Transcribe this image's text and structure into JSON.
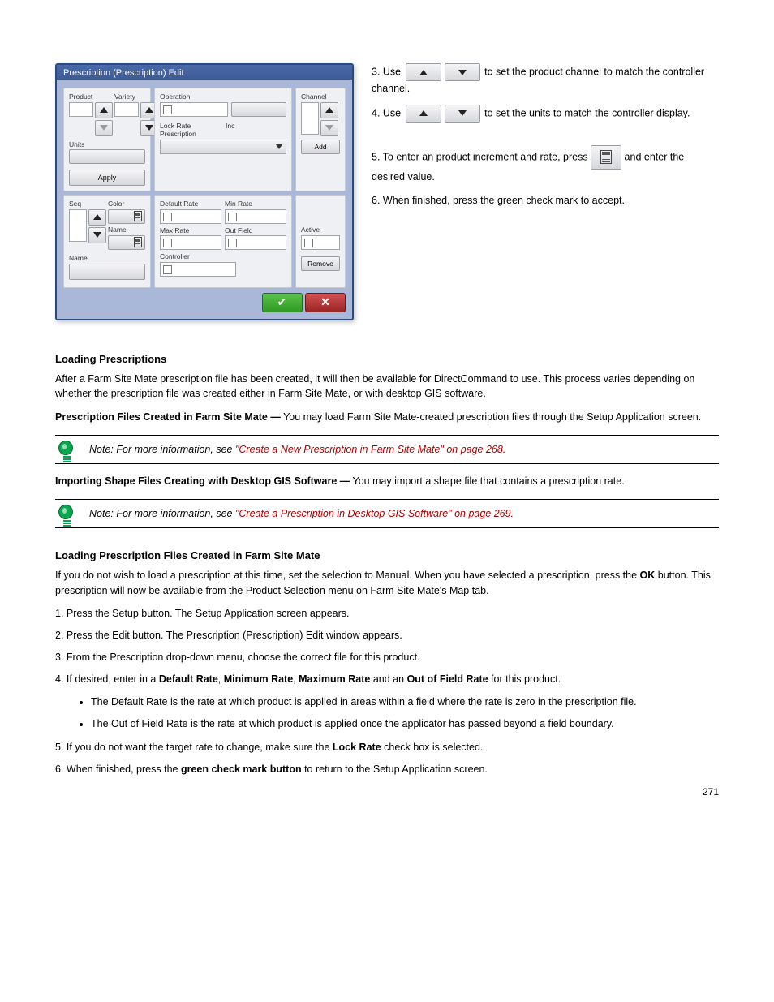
{
  "dialog": {
    "title": "Prescription (Prescription) Edit",
    "col_a": {
      "product_label": "Product",
      "variety_label": "Variety",
      "units_label": "Units",
      "apply_btn": "Apply",
      "seq_label": "Seq",
      "color_label": "Color",
      "name1_label": "Name",
      "name2_label": "Name"
    },
    "col_b": {
      "operation_label": "Operation",
      "inc_label": "Inc",
      "lockrate_label": "Lock Rate",
      "prescription_label": "Prescription",
      "defaultrate_label": "Default Rate",
      "minrate_label": "Min Rate",
      "maxrate_label": "Max Rate",
      "outfield_label": "Out Field",
      "controller_label": "Controller"
    },
    "col_c": {
      "channel_label": "Channel",
      "add_btn": "Add",
      "active_label": "Active",
      "remove_btn": "Remove"
    },
    "ok": "✓",
    "cancel": "✕"
  },
  "side": {
    "s1a": "3. Use ",
    "s1b": " to set the product channel to match the controller channel.",
    "s2a": "4. Use ",
    "s2b": " to set the units to match the controller display.",
    "s3a": "5. To enter an product increment and rate, press ",
    "s3b": " and enter the desired value.",
    "s4": "6. When finished, press the green check mark to accept."
  },
  "heading1": "Loading Prescriptions",
  "para1": "After a Farm Site Mate prescription file has been created, it will then be available for DirectCommand to use. This process varies depending on whether the prescription file was created either in Farm Site Mate, or with desktop GIS software.",
  "para2a": "Prescription Files Created in Farm Site Mate —",
  "para2b": " You may load Farm Site Mate-created prescription files through the Setup Application screen.",
  "tip1a": "Note:",
  "tip1b": " For more information, see ",
  "tip1c": "\"Create a New Prescription in Farm Site Mate\" on page 268.",
  "para3a": "Importing Shape Files Creating with Desktop GIS Software —",
  "para3b": " You may import a shape file that contains a prescription rate.",
  "tip2a": "Note:",
  "tip2b": " For more information, see ",
  "tip2c": "\"Create a Prescription in Desktop GIS Software\" on page 269.",
  "heading2": "Loading Prescription Files Created in Farm Site Mate",
  "para4a": "If you do not wish to load a prescription at this time, set the selection to Manual. When you have selected a prescription, press the ",
  "para4b": "OK",
  "para4c": " button. This prescription will now be available from the Product Selection menu on Farm Site Mate's Map tab.",
  "step1": "1. Press the Setup button. The Setup Application screen appears.",
  "step2": "2. Press the Edit button. The Prescription (Prescription) Edit window appears.",
  "step3": "3. From the Prescription drop-down menu, choose the correct file for this product.",
  "step4a": "4. If desired, enter in a ",
  "step4b": "Default Rate",
  "step4c": ", ",
  "step4d": "Minimum Rate",
  "step4e": ", ",
  "step4f": "Maximum Rate",
  "step4g": " and an ",
  "step4h": "Out of Field Rate",
  "step4i": " for this product.",
  "step5_1": "The Default Rate is the rate at which product is applied in areas within a field where the rate is zero in the prescription file.",
  "step5_2": "The Out of Field Rate is the rate at which product is applied once the applicator has passed beyond a field boundary.",
  "step6a": "5. If you do not want the target rate to change, make sure the ",
  "step6b": "Lock Rate",
  "step6c": " check box is selected.",
  "step7a": "6. When finished, press the ",
  "step7b": "green check mark button",
  "step7c": " to return to the Setup Application screen.",
  "pagenum": "271"
}
